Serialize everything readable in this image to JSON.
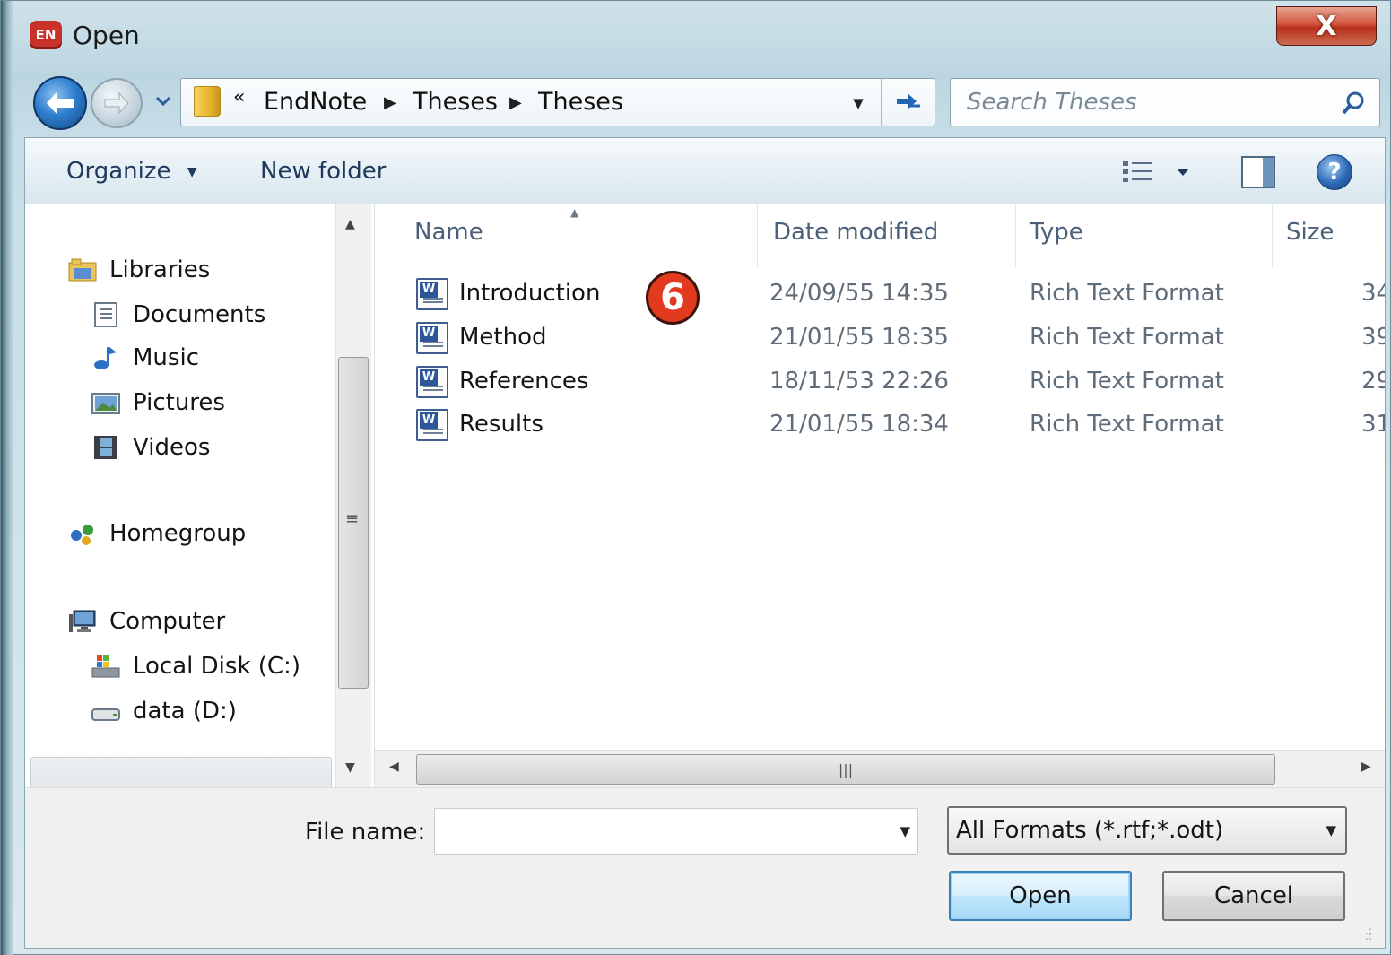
{
  "window": {
    "title": "Open",
    "app_icon_label": "EN"
  },
  "close_button": {
    "label": "X"
  },
  "address": {
    "overflow": "«",
    "crumbs": [
      "EndNote",
      "Theses",
      "Theses"
    ]
  },
  "search": {
    "placeholder": "Search Theses"
  },
  "toolbar": {
    "organize": "Organize",
    "new_folder": "New folder"
  },
  "help": {
    "label": "?"
  },
  "nav": {
    "libraries": "Libraries",
    "documents": "Documents",
    "music": "Music",
    "pictures": "Pictures",
    "videos": "Videos",
    "homegroup": "Homegroup",
    "computer": "Computer",
    "local_disk": "Local Disk (C:)",
    "data_drive": "data (D:)"
  },
  "columns": {
    "name": "Name",
    "date": "Date modified",
    "type": "Type",
    "size": "Size"
  },
  "files": [
    {
      "name": "Introduction",
      "date": "24/09/55 14:35",
      "type": "Rich Text Format",
      "size": "34"
    },
    {
      "name": "Method",
      "date": "21/01/55 18:35",
      "type": "Rich Text Format",
      "size": "39"
    },
    {
      "name": "References",
      "date": "18/11/53 22:26",
      "type": "Rich Text Format",
      "size": "29"
    },
    {
      "name": "Results",
      "date": "21/01/55 18:34",
      "type": "Rich Text Format",
      "size": "31"
    }
  ],
  "annotation": {
    "step": "6"
  },
  "bottom": {
    "filename_label": "File name:",
    "filename_value": "",
    "filter": "All Formats (*.rtf;*.odt)",
    "open": "Open",
    "cancel": "Cancel"
  }
}
